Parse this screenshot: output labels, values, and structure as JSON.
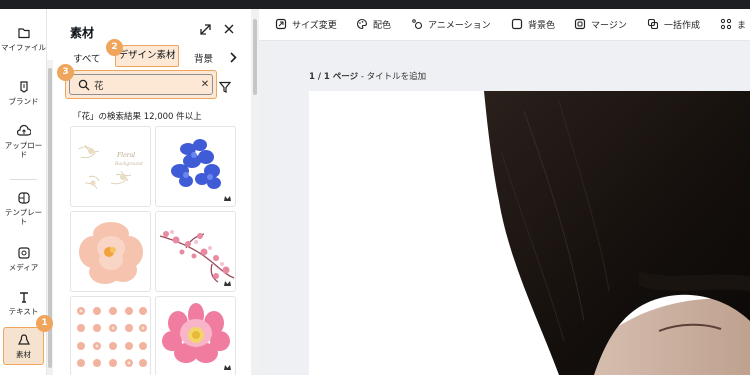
{
  "rail": {
    "items": [
      {
        "label": "マイファイル",
        "icon": "folder-icon"
      },
      {
        "label": "ブランド",
        "icon": "brand-icon"
      },
      {
        "label": "アップロード",
        "icon": "upload-icon"
      },
      {
        "label": "テンプレート",
        "icon": "template-icon"
      },
      {
        "label": "メディア",
        "icon": "media-icon"
      },
      {
        "label": "テキスト",
        "icon": "text-icon"
      },
      {
        "label": "素材",
        "icon": "elements-icon"
      }
    ],
    "active_color": "#f5e2cf"
  },
  "panel": {
    "title": "素材",
    "tabs": [
      "すべて",
      "デザイン素材",
      "背景"
    ],
    "search": {
      "value": "花",
      "placeholder": "検索"
    },
    "result_text": "「花」の検索結果 12,000 件以上"
  },
  "badges": [
    "1",
    "2",
    "3"
  ],
  "toolbar": {
    "items": [
      {
        "label": "サイズ変更",
        "icon": "resize-icon"
      },
      {
        "label": "配色",
        "icon": "palette-icon"
      },
      {
        "label": "アニメーション",
        "icon": "animation-icon"
      },
      {
        "label": "背景色",
        "icon": "checkbox-icon"
      },
      {
        "label": "マージン",
        "icon": "margin-icon"
      },
      {
        "label": "一括作成",
        "icon": "bulk-create-icon"
      },
      {
        "label": "ま",
        "icon": "more-icon"
      }
    ]
  },
  "page": {
    "number": "1 / 1 ページ",
    "separator": " - ",
    "title_placeholder": "タイトルを追加"
  },
  "colors": {
    "highlight": "#efa55b",
    "highlight_bg": "#fce8d4",
    "dark_strip": "#1d1f23"
  }
}
